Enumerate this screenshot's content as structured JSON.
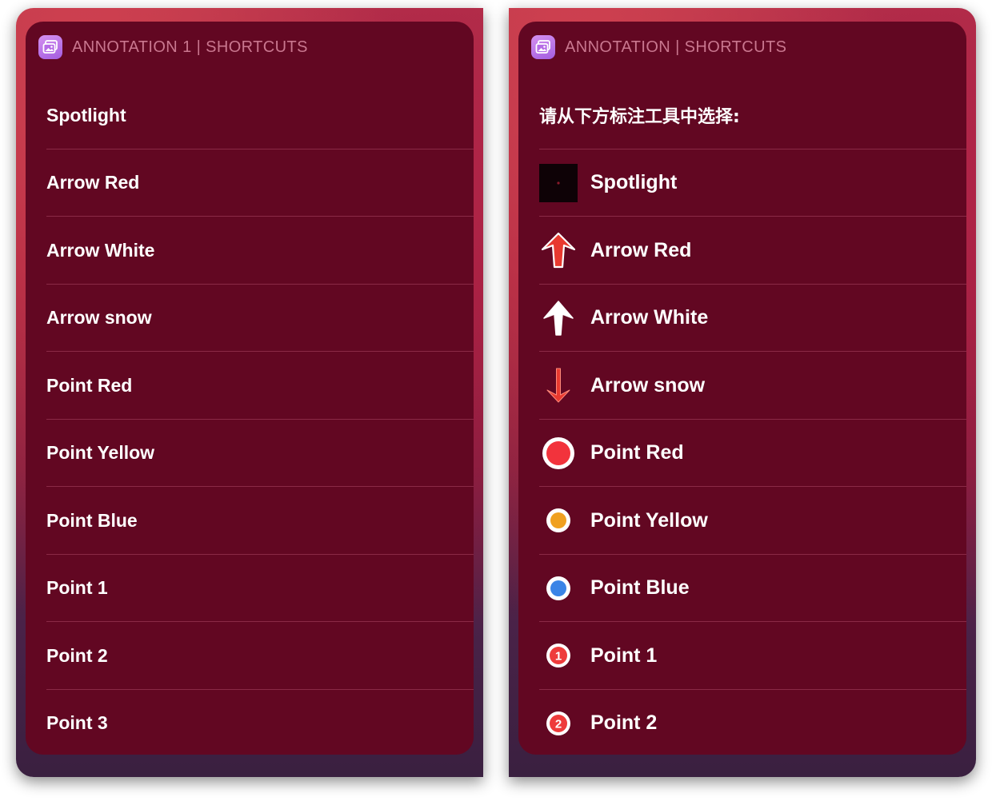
{
  "left_panel": {
    "title": "ANNOTATION 1 | SHORTCUTS",
    "items": [
      {
        "label": "Spotlight"
      },
      {
        "label": "Arrow Red"
      },
      {
        "label": "Arrow White"
      },
      {
        "label": "Arrow snow"
      },
      {
        "label": "Point Red"
      },
      {
        "label": "Point Yellow"
      },
      {
        "label": "Point Blue"
      },
      {
        "label": "Point 1"
      },
      {
        "label": "Point 2"
      },
      {
        "label": "Point 3"
      }
    ]
  },
  "right_panel": {
    "title": "ANNOTATION | SHORTCUTS",
    "prompt": "请从下方标注工具中选择:",
    "items": [
      {
        "label": "Spotlight",
        "icon": "spotlight-icon"
      },
      {
        "label": "Arrow Red",
        "icon": "arrow-red-up-icon"
      },
      {
        "label": "Arrow White",
        "icon": "arrow-white-up-icon"
      },
      {
        "label": "Arrow snow",
        "icon": "arrow-red-down-icon"
      },
      {
        "label": "Point Red",
        "icon": "point-red-icon"
      },
      {
        "label": "Point Yellow",
        "icon": "point-yellow-icon"
      },
      {
        "label": "Point Blue",
        "icon": "point-blue-icon"
      },
      {
        "label": "Point 1",
        "icon": "point-number-1-icon",
        "badge": "1"
      },
      {
        "label": "Point 2",
        "icon": "point-number-2-icon",
        "badge": "2"
      }
    ]
  },
  "colors": {
    "panel": "#620722",
    "title": "#c9778f",
    "separator": "#8a2a46",
    "red": "#ee3b3b",
    "yellow": "#f0a020",
    "blue": "#3a84e6"
  }
}
